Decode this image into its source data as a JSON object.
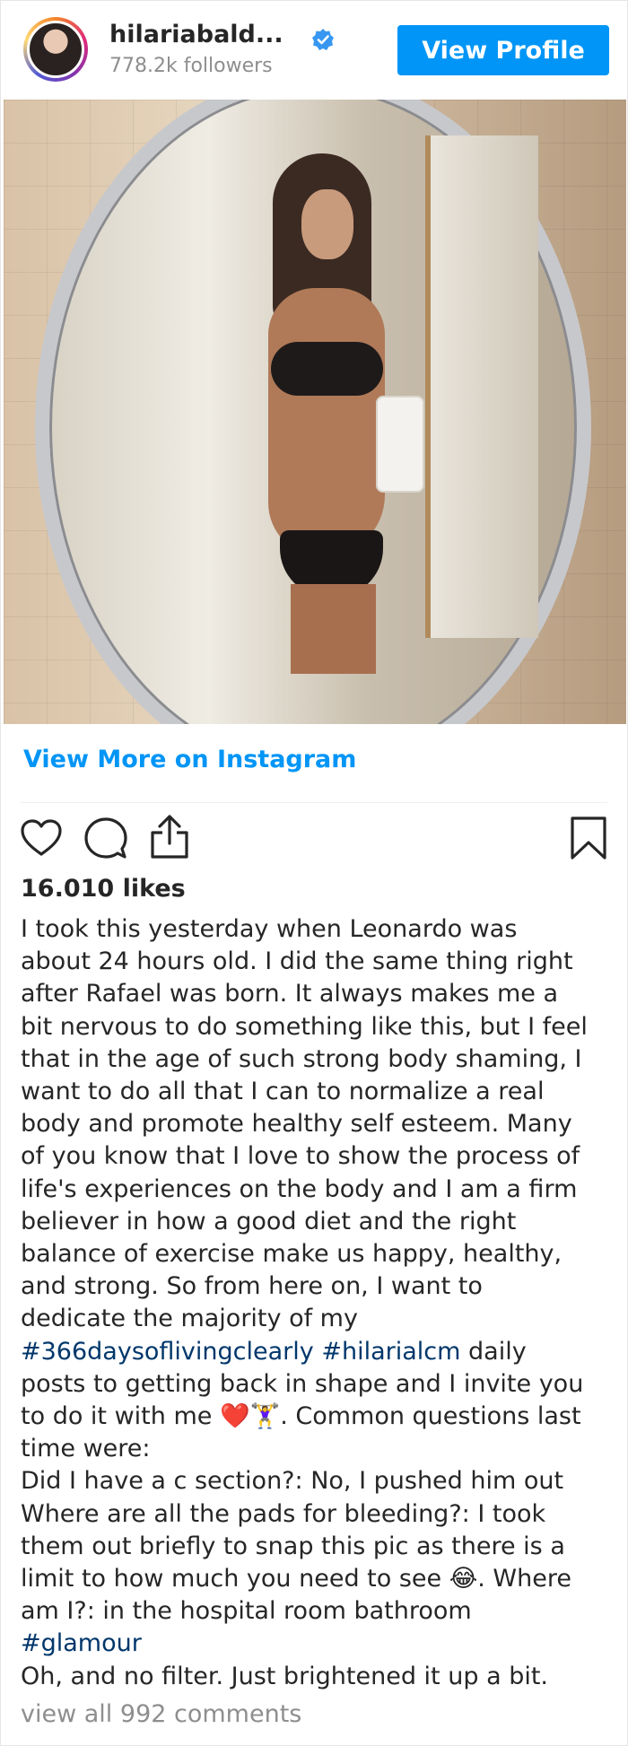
{
  "header": {
    "username": "hilariabald...",
    "followers": "778.2k followers",
    "view_profile_label": "View Profile"
  },
  "colors": {
    "accent": "#0095f6",
    "hashtag": "#00376b",
    "muted": "#8e8e8e",
    "text": "#262626",
    "verified": "#3897f0"
  },
  "post": {
    "view_more_label": "View More on Instagram",
    "likes": "16.010 likes",
    "caption": {
      "l1": "I took this yesterday when Leonardo was",
      "l2": "about 24 hours old. I did the same thing right",
      "l3": "after Rafael was born. It always makes me a",
      "l4": "bit nervous to do something like this, but I feel",
      "l5": "that in the age of such strong body shaming, I",
      "l6": "want to do all that I can to normalize a real",
      "l7": "body and promote healthy self esteem. Many",
      "l8": "of you know that I love to show the process of",
      "l9": "life's experiences on the body and I am a firm",
      "l10": "believer in how a good diet and the right",
      "l11": "balance of exercise make us happy, healthy,",
      "l12": "and strong. So from here on, I want to",
      "l13": "dedicate the majority of my",
      "hashtag1": "#366daysoflivingclearly",
      "hashtag2": "#hilarialcm",
      "l14_tail": " daily",
      "l15": "posts to getting back in shape and I invite you",
      "l16": "to do it with me ❤️🏋️‍♀️. Common questions last",
      "l17": "time were:",
      "l18": "Did I have a c section?: No, I pushed him out",
      "l19": "Where are all the pads for bleeding?: I took",
      "l20": "them out briefly to snap this pic as there is a",
      "l21": "limit to how much you need to see 😂. Where",
      "l22": "am I?: in the hospital room bathroom",
      "hashtag3": "#glamour",
      "l24": "Oh, and no filter. Just brightened it up a bit."
    },
    "view_comments_label": "view all 992 comments"
  },
  "icons": [
    "heart-icon",
    "comment-icon",
    "share-icon",
    "bookmark-icon",
    "verified-badge-icon"
  ]
}
